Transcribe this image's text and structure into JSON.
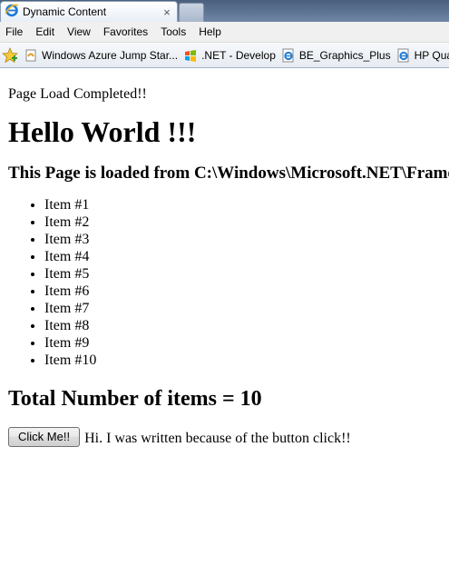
{
  "browser": {
    "tab_title": "Dynamic Content",
    "tab_close": "×",
    "menu": [
      "File",
      "Edit",
      "View",
      "Favorites",
      "Tools",
      "Help"
    ],
    "favorites": [
      {
        "label": "Windows Azure Jump Star...",
        "icon": "azure-page-icon"
      },
      {
        "label": ".NET - Develop",
        "icon": "windows-flag-icon"
      },
      {
        "label": "BE_Graphics_Plus",
        "icon": "ie-page-icon"
      },
      {
        "label": "HP Quali",
        "icon": "ie-page-icon"
      }
    ]
  },
  "page": {
    "status": "Page Load Completed!!",
    "heading": "Hello World !!!",
    "subheading": "This Page is loaded from C:\\Windows\\Microsoft.NET\\Framewo",
    "items": [
      "Item #1",
      "Item #2",
      "Item #3",
      "Item #4",
      "Item #5",
      "Item #6",
      "Item #7",
      "Item #8",
      "Item #9",
      "Item #10"
    ],
    "total": "Total Number of items = 10",
    "button_label": "Click Me!!",
    "message": "Hi. I was written because of the button click!!"
  }
}
